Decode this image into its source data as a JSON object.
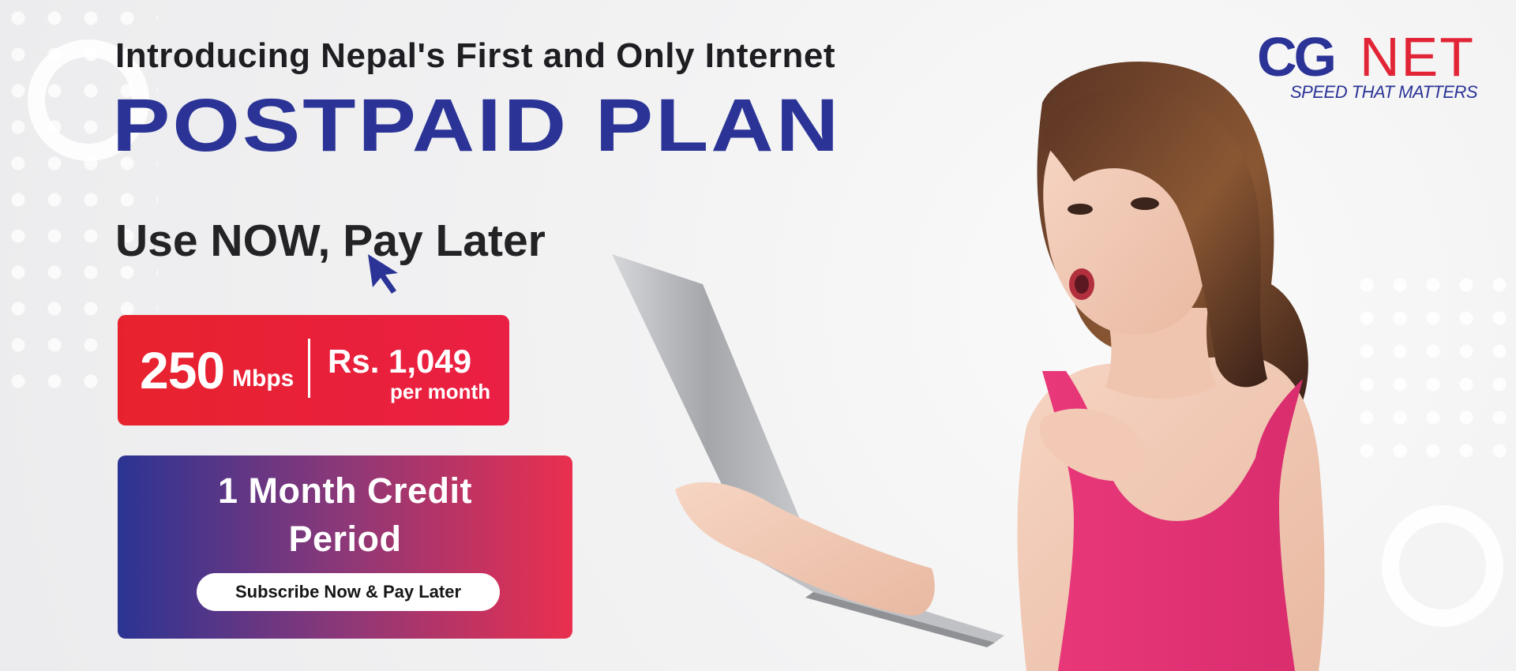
{
  "banner": {
    "intro": "Introducing Nepal's First and Only Internet",
    "headline": "POSTPAID PLAN",
    "tagline": "Use NOW, Pay Later",
    "cursor_icon": "pointer-cursor-icon"
  },
  "price_card": {
    "speed_value": "250",
    "speed_unit": "Mbps",
    "price_value": "Rs. 1,049",
    "price_period": "per month",
    "colors": {
      "start": "#e8222d",
      "end": "#ea1f44"
    }
  },
  "credit_card": {
    "title": "1 Month Credit",
    "title_line2": "Period",
    "subscribe_label": "Subscribe Now & Pay Later",
    "colors": {
      "start": "#2b3493",
      "middle": "#8d3878",
      "end": "#ea2f4f"
    }
  },
  "logo": {
    "brand_left": "CG",
    "brand_right": "NET",
    "tagline": "SPEED THAT MATTERS",
    "colors": {
      "blue": "#2b3496",
      "red": "#e22536"
    }
  },
  "hero": {
    "subject": "woman-holding-laptop-image"
  },
  "theme": {
    "background": "#f1f1f2",
    "primary": "#2b3496",
    "accent": "#e22536",
    "text": "#1e1e22"
  }
}
